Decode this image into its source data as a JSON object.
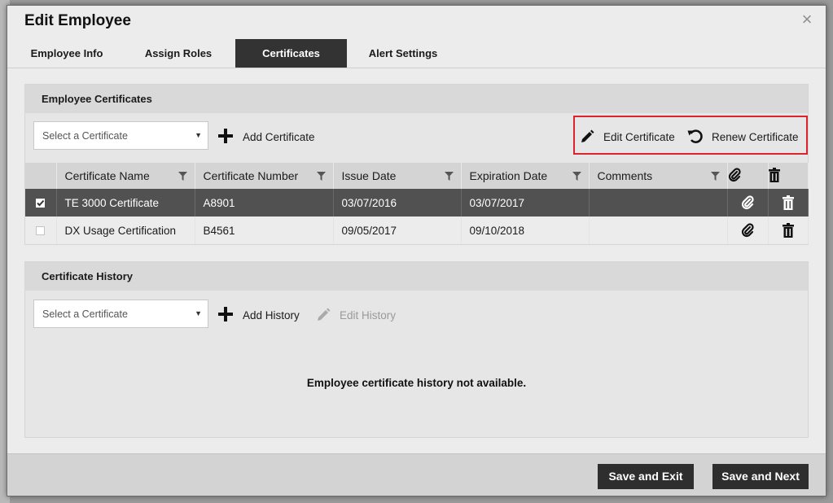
{
  "dialog": {
    "title": "Edit Employee",
    "close_label": "×"
  },
  "tabs": [
    {
      "label": "Employee Info",
      "active": false
    },
    {
      "label": "Assign Roles",
      "active": false
    },
    {
      "label": "Certificates",
      "active": true
    },
    {
      "label": "Alert Settings",
      "active": false
    }
  ],
  "employee_certificates": {
    "title": "Employee Certificates",
    "select_placeholder": "Select a Certificate",
    "add_label": "Add Certificate",
    "edit_label": "Edit Certificate",
    "renew_label": "Renew Certificate",
    "columns": [
      "Certificate Name",
      "Certificate Number",
      "Issue Date",
      "Expiration Date",
      "Comments"
    ],
    "rows": [
      {
        "selected": true,
        "name": "TE 3000 Certificate",
        "number": "A8901",
        "issue_date": "03/07/2016",
        "expiration_date": "03/07/2017",
        "comments": ""
      },
      {
        "selected": false,
        "name": "DX Usage Certification",
        "number": "B4561",
        "issue_date": "09/05/2017",
        "expiration_date": "09/10/2018",
        "comments": ""
      }
    ]
  },
  "certificate_history": {
    "title": "Certificate History",
    "select_placeholder": "Select a Certificate",
    "add_label": "Add History",
    "edit_label": "Edit History",
    "empty_message": "Employee certificate history not available."
  },
  "footer": {
    "save_exit_label": "Save and Exit",
    "save_next_label": "Save and Next"
  },
  "colors": {
    "active_tab": "#333333",
    "selected_row": "#515151",
    "highlight_border": "#d9232e",
    "button": "#2e2e2e"
  }
}
